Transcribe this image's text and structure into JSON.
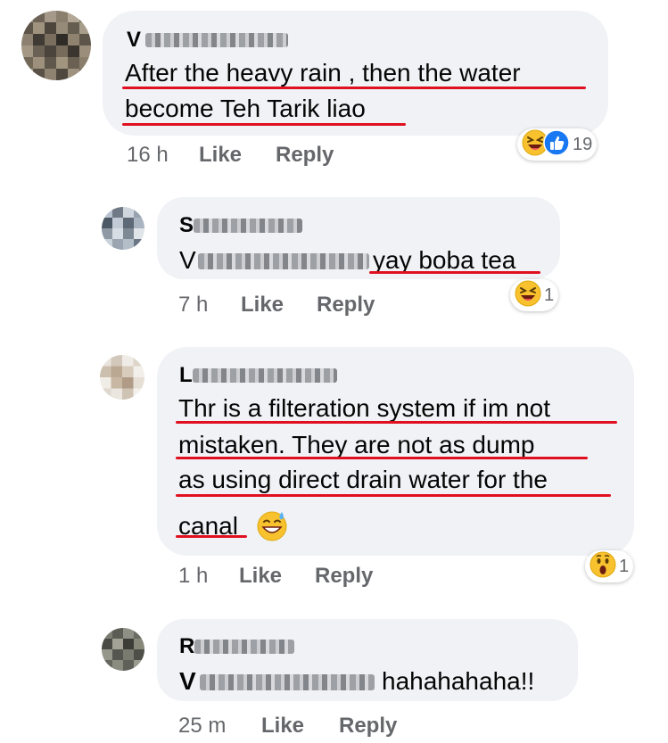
{
  "comments": [
    {
      "name_visible": "V",
      "lines": [
        "After the heavy rain , then the water",
        "become Teh Tarik liao"
      ],
      "time": "16 h",
      "like_label": "Like",
      "reply_label": "Reply",
      "reactions": [
        "laugh-emoji",
        "like-icon"
      ],
      "reaction_count": "19"
    },
    {
      "name_visible": "S",
      "mention_visible": "V",
      "text": "yay boba tea",
      "time": "7 h",
      "like_label": "Like",
      "reply_label": "Reply",
      "reactions": [
        "laugh-emoji"
      ],
      "reaction_count": "1"
    },
    {
      "name_visible": "L",
      "lines": [
        "Thr is a filteration system if im not",
        "mistaken. They are not as dump",
        "as using direct drain water for the",
        "canal"
      ],
      "emoji": "grin-sweat-emoji",
      "time": "1 h",
      "like_label": "Like",
      "reply_label": "Reply",
      "reactions": [
        "wow-emoji"
      ],
      "reaction_count": "1"
    },
    {
      "name_visible": "R",
      "mention_visible": "V",
      "text": "hahahahaha!!",
      "time": "25 m",
      "like_label": "Like",
      "reply_label": "Reply"
    }
  ],
  "colors": {
    "bubble": "#f0f2f5",
    "meta_text": "#65676b",
    "underline": "#e01020",
    "like_blue": "#1877f2"
  }
}
